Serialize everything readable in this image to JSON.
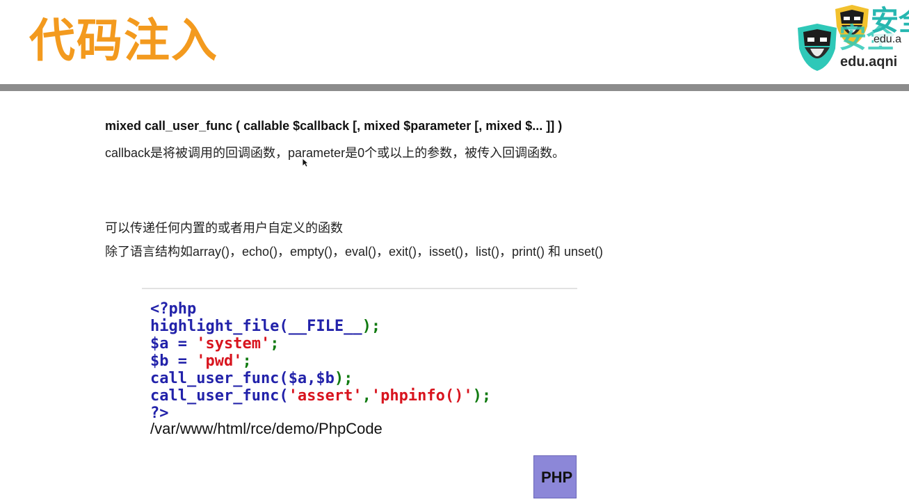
{
  "slide": {
    "title": "代码注入"
  },
  "logo": {
    "brand_text": "安全",
    "url_text": "edu.aqni",
    "url_text_small": "edu.a"
  },
  "content": {
    "signature": "mixed call_user_func ( callable $callback [, mixed $parameter [, mixed $... ]] )",
    "description": "callback是将被调用的回调函数，parameter是0个或以上的参数，被传入回调函数。",
    "note_1": "可以传递任何内置的或者用户自定义的函数",
    "note_2": "除了语言结构如array()，echo()，empty()，eval()，exit()，isset()，list()，print() 和 unset()"
  },
  "code": {
    "open_tag": "<?php",
    "line_highlight_fn": "highlight_file(",
    "line_highlight_const": "__FILE__",
    "line_highlight_end": ");",
    "line_a_var": "$a = ",
    "line_a_str": "'system'",
    "line_a_end": ";",
    "line_b_var": "$b = ",
    "line_b_str": "'pwd'",
    "line_b_end": ";",
    "line_call1_fn": "call_user_func(",
    "line_call1_args": "$a,$b",
    "line_call1_end": ");",
    "line_call2_fn": "call_user_func(",
    "line_call2_str1": "'assert'",
    "line_call2_comma": ",",
    "line_call2_str2": "'phpinfo()'",
    "line_call2_end": ");",
    "close_tag": "?>",
    "output_path": "/var/www/html/rce/demo/PhpCode"
  },
  "badge": {
    "label": "PHP"
  },
  "colors": {
    "title": "#f39a1e",
    "divider": "#8c8c8c",
    "keyword": "#2222aa",
    "string": "#d8141e",
    "punctuation": "#107a10",
    "logo_accent": "#26b7b0",
    "badge_bg": "#8c87d8"
  },
  "icons": {
    "logo": "bearded-warrior-helmet-icon",
    "cursor": "mouse-pointer-icon"
  }
}
